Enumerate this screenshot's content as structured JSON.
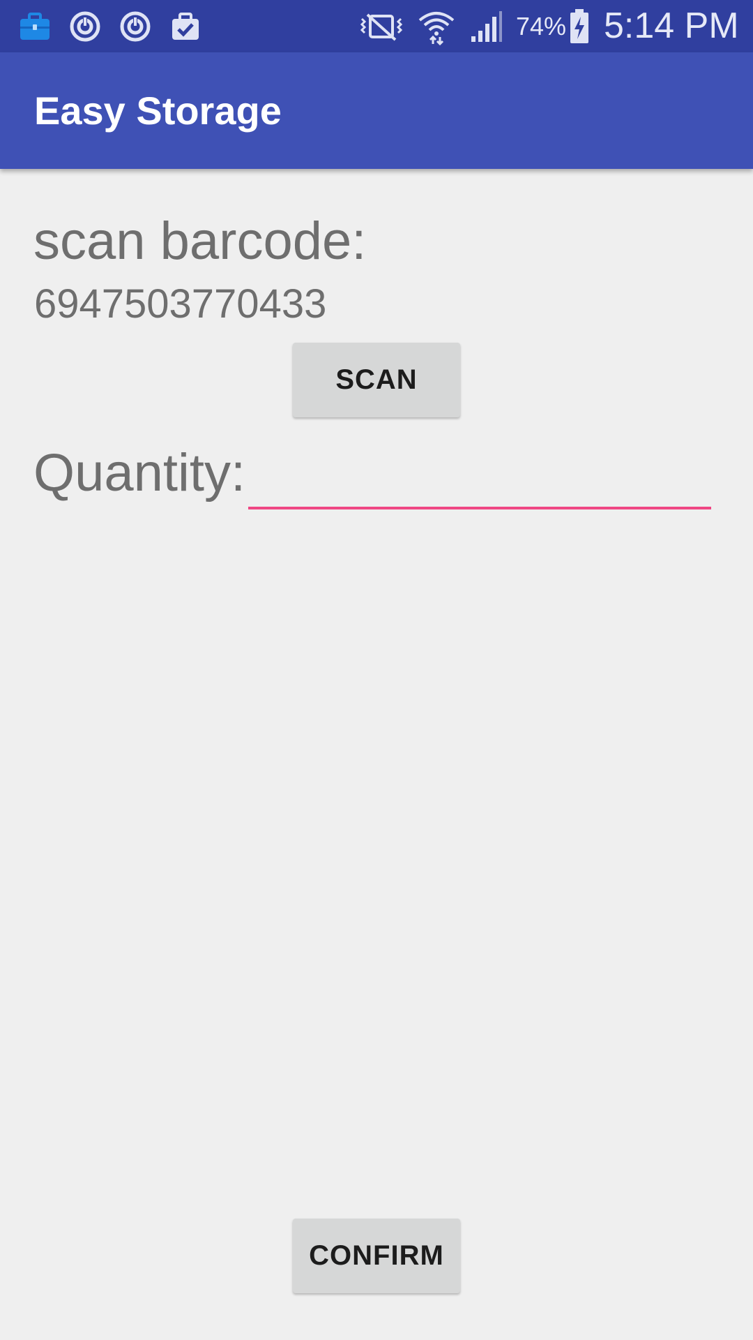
{
  "status_bar": {
    "icons_left": [
      "briefcase-icon",
      "sync-icon",
      "sync-icon",
      "clipboard-check-icon"
    ],
    "icons_right": [
      "vibrate-off-icon",
      "wifi-icon",
      "signal-icon",
      "battery-charging-icon"
    ],
    "battery_percent": "74%",
    "time": "5:14 PM",
    "colors": {
      "background": "#303f9f",
      "briefcase": "#1e88e5"
    }
  },
  "app_bar": {
    "title": "Easy Storage",
    "color": "#3f51b5"
  },
  "main": {
    "scan_label": "scan barcode:",
    "barcode_value": "6947503770433",
    "scan_button_label": "SCAN",
    "quantity_label": "Quantity:",
    "quantity_value": "",
    "quantity_placeholder": "",
    "confirm_button_label": "CONFIRM",
    "accent_color": "#ef4784"
  }
}
